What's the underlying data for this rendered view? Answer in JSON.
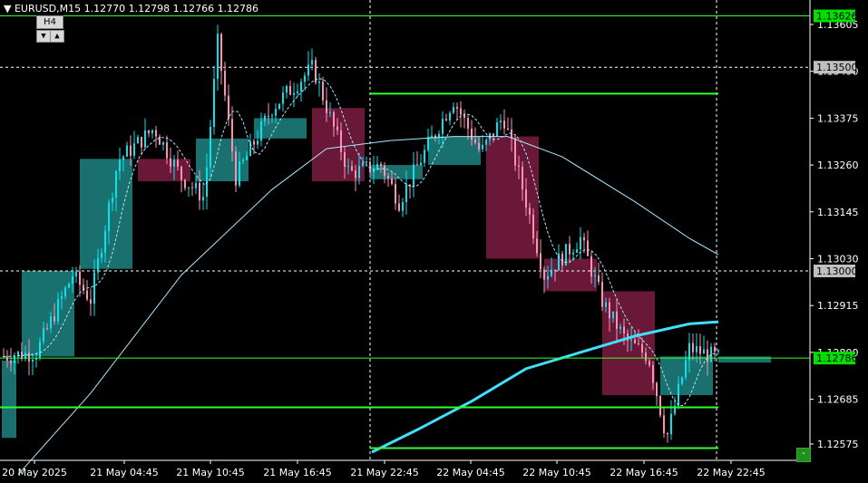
{
  "header": {
    "symbol_tf": "EURUSD,M15",
    "ohlc": "1.12770 1.12798 1.12766 1.12786"
  },
  "tf_widget": {
    "label": "H4",
    "down_glyph": "▼",
    "up_glyph": "▲"
  },
  "price_axis": {
    "ticks": [
      "1.13605",
      "1.13490",
      "1.13375",
      "1.13260",
      "1.13145",
      "1.13030",
      "1.12915",
      "1.12800",
      "1.12685",
      "1.12575"
    ],
    "tags": [
      {
        "price": 1.13626,
        "label": "1.13626",
        "bg": "#00e000",
        "fg": "#000000"
      },
      {
        "price": 1.135,
        "label": "1.13500",
        "bg": "#c0c0c0",
        "fg": "#000000"
      },
      {
        "price": 1.13,
        "label": "1.13000",
        "bg": "#c0c0c0",
        "fg": "#000000"
      },
      {
        "price": 1.12786,
        "label": "1.12786",
        "bg": "#00e000",
        "fg": "#000000"
      }
    ]
  },
  "time_axis": {
    "labels": [
      "20 May 2025",
      "21 May 04:45",
      "21 May 10:45",
      "21 May 16:45",
      "21 May 22:45",
      "22 May 04:45",
      "22 May 10:45",
      "22 May 16:45",
      "22 May 22:45"
    ]
  },
  "levels": {
    "horizontal_lines": [
      1.13626,
      1.12786
    ],
    "dotted_lines": [
      1.135,
      1.13
    ],
    "segments": [
      {
        "price": 1.13435,
        "from": "21 May 22:45",
        "to": "22 May 22:45"
      },
      {
        "price": 1.12665,
        "from": "20 May 2025",
        "to": "22 May 22:45"
      },
      {
        "price": 1.12565,
        "from": "21 May 22:45",
        "to": "22 May 22:45"
      }
    ],
    "vertical_dotted": [
      "21 May 22:45",
      "22 May 22:45"
    ]
  },
  "colors": {
    "bull": "#00e5ee",
    "bear": "#ff8fb3",
    "h4_bull": "#1a6f6f",
    "h4_bear": "#6a1838",
    "ma_fast": "#a8e8ff",
    "ma_slow": "#40dfff",
    "level": "#32ff32"
  },
  "corner_button": {
    "glyph": "-"
  }
}
